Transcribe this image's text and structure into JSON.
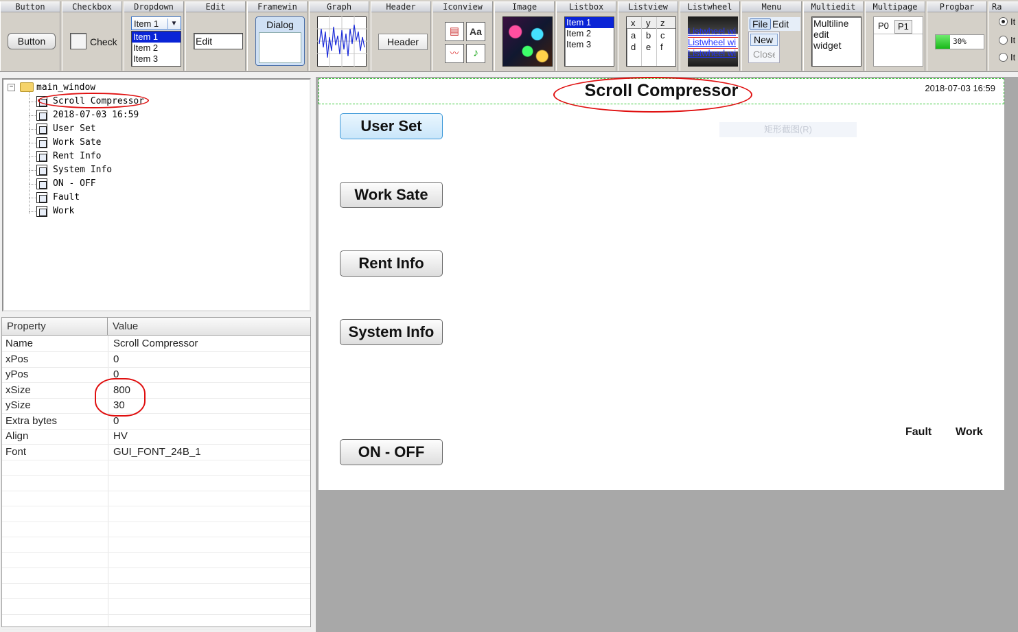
{
  "toolbar": {
    "palettes": [
      {
        "title": "Button"
      },
      {
        "title": "Checkbox"
      },
      {
        "title": "Dropdown"
      },
      {
        "title": "Edit"
      },
      {
        "title": "Framewin"
      },
      {
        "title": "Graph"
      },
      {
        "title": "Header"
      },
      {
        "title": "Iconview"
      },
      {
        "title": "Image"
      },
      {
        "title": "Listbox"
      },
      {
        "title": "Listview"
      },
      {
        "title": "Listwheel"
      },
      {
        "title": "Menu"
      },
      {
        "title": "Multiedit"
      },
      {
        "title": "Multipage"
      },
      {
        "title": "Progbar"
      },
      {
        "title": "Ra"
      }
    ],
    "button_label": "Button",
    "checkbox_label": "Check",
    "dropdown": {
      "value": "Item 1",
      "items": [
        "Item 1",
        "Item 2",
        "Item 3"
      ]
    },
    "edit_value": "Edit",
    "framewin_title": "Dialog",
    "header_label": "Header",
    "listbox_items": [
      "Item 1",
      "Item 2",
      "Item 3"
    ],
    "listview": {
      "cols": [
        "x",
        "y",
        "z"
      ],
      "row1": [
        "a",
        "b",
        "c"
      ],
      "row2": [
        "d",
        "e",
        "f"
      ]
    },
    "listwheel_items": [
      "Listwheel wi",
      "Listwheel wi",
      "Listwheel wi"
    ],
    "menu": {
      "file": "File",
      "edit": "Edit",
      "new": "New",
      "close": "Close"
    },
    "multiedit_text": [
      "Multiline",
      "edit",
      "widget"
    ],
    "multipage_tabs": [
      "P0",
      "P1"
    ],
    "progbar": {
      "label": "30%",
      "value": 0.3
    },
    "radio_labels": [
      "It",
      "It",
      "It"
    ],
    "accent": "#0a24d6"
  },
  "tree": {
    "root": "main_window",
    "children": [
      "Scroll Compressor",
      "2018-07-03 16:59",
      "User Set",
      "Work Sate",
      "Rent Info",
      "System Info",
      "ON - OFF",
      "Fault",
      "Work"
    ]
  },
  "properties": {
    "headers": {
      "property": "Property",
      "value": "Value"
    },
    "rows": [
      {
        "name": "Name",
        "value": "Scroll Compressor"
      },
      {
        "name": "xPos",
        "value": "0"
      },
      {
        "name": "yPos",
        "value": "0"
      },
      {
        "name": "xSize",
        "value": "800"
      },
      {
        "name": "ySize",
        "value": "30"
      },
      {
        "name": "Extra bytes",
        "value": "0"
      },
      {
        "name": "Align",
        "value": "HV"
      },
      {
        "name": "Font",
        "value": "GUI_FONT_24B_1"
      }
    ]
  },
  "screen": {
    "title": "Scroll Compressor",
    "datetime": "2018-07-03 16:59",
    "watermark": "矩形截图(R)",
    "buttons": {
      "user_set": "User Set",
      "work_sate": "Work Sate",
      "rent_info": "Rent Info",
      "system_info": "System Info",
      "on_off": "ON - OFF"
    },
    "fault": "Fault",
    "work": "Work"
  }
}
